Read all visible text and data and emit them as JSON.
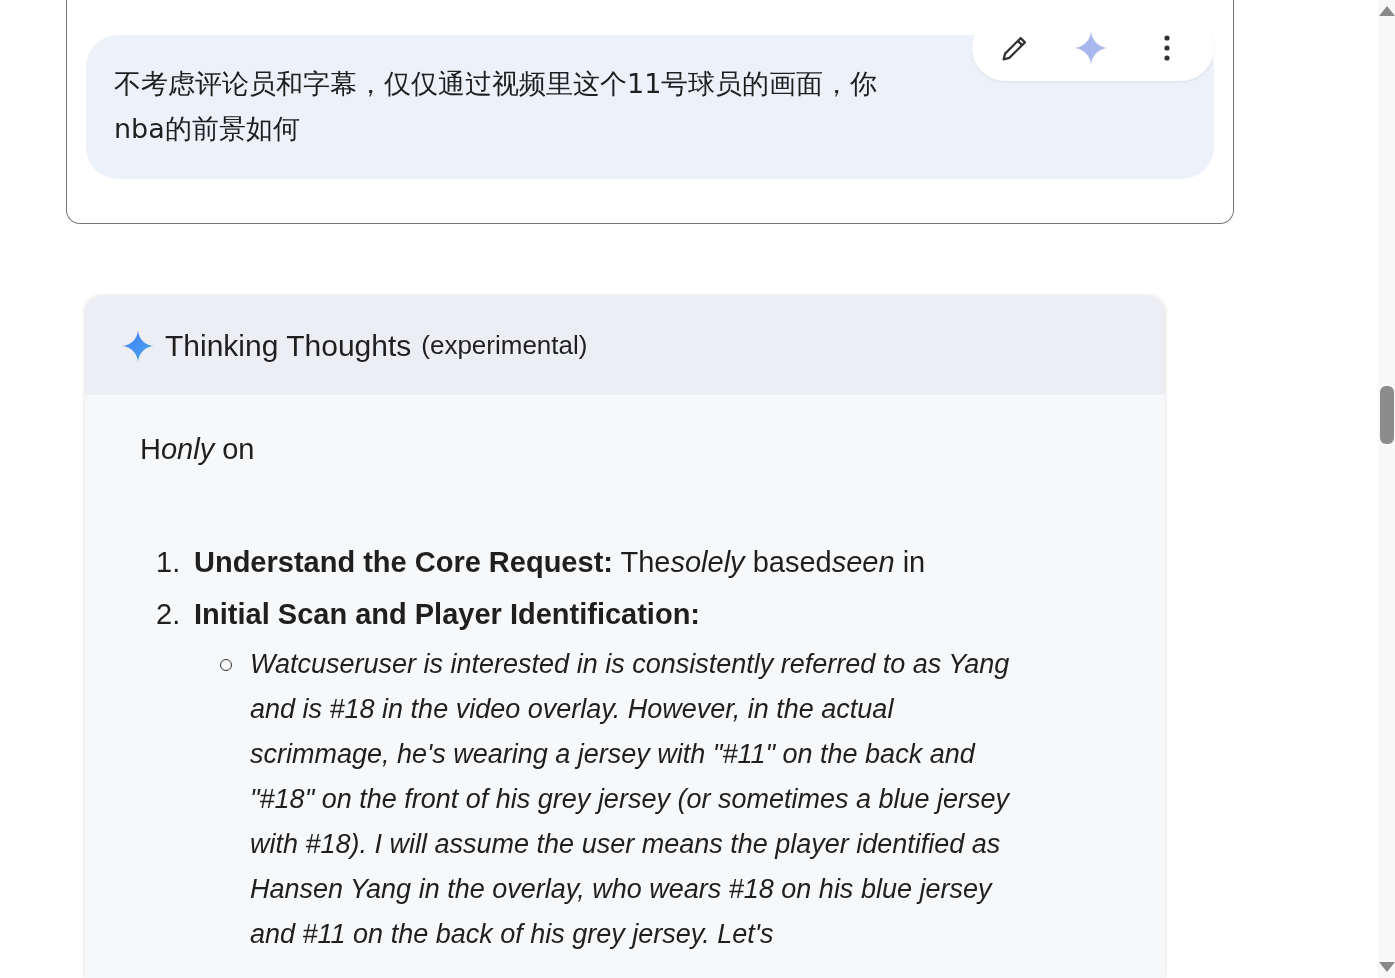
{
  "prompt": {
    "lines": [
      "不考虑评论员和字幕，仅仅通过视频里这个11号球员的画面，你",
      "nba的前景如何"
    ]
  },
  "prompt_toolbar": {
    "buttons": [
      {
        "kind": "edit"
      },
      {
        "kind": "sparkle"
      },
      {
        "kind": "more"
      }
    ]
  },
  "thoughts": {
    "title": "Thinking Thoughts",
    "subtitle": "(experimental)",
    "intro": [
      {
        "text": "H",
        "italic": false
      },
      {
        "text": "only",
        "italic": true
      },
      {
        "text": " on",
        "italic": false
      }
    ],
    "steps": [
      {
        "number": "1.",
        "label": "Understand the Core Request:",
        "runs": [
          {
            "text": " The",
            "italic": false
          },
          {
            "text": "solely",
            "italic": true
          },
          {
            "text": " based",
            "italic": false
          },
          {
            "text": "seen",
            "italic": true
          },
          {
            "text": " in",
            "italic": false
          }
        ]
      },
      {
        "number": "2.",
        "label": "Initial Scan and Player Identification:",
        "bullets": [
          "Watcuseruser is interested in is consistently referred to as Yang and is #18 in the video overlay. However, in the actual scrimmage, he's wearing a jersey with \"#11\" on the back and \"#18\" on the front of his grey jersey (or sometimes a blue jersey with #18). I will assume the user means the player identified as Hansen Yang in the overlay, who wears #18 on his blue jersey and #11 on the back of his grey jersey. Let's"
        ]
      }
    ]
  }
}
